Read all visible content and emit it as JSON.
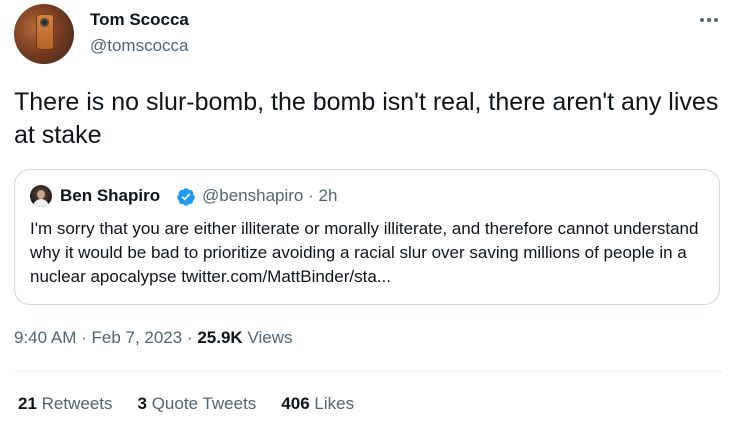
{
  "tweet": {
    "author": {
      "name": "Tom Scocca",
      "handle": "@tomscocca"
    },
    "text": "There is no slur-bomb, the bomb isn't real, there aren't any lives at stake",
    "quote": {
      "author": {
        "name": "Ben Shapiro",
        "handle": "@benshapiro",
        "verified": true
      },
      "time_sep": " · ",
      "time": "2h",
      "text": "I'm sorry that you are either illiterate or morally illiterate, and therefore cannot understand why it would be bad to prioritize avoiding a racial slur over saving millions of people in a nuclear apocalypse twitter.com/MattBinder/sta..."
    },
    "meta": {
      "time": "9:40 AM",
      "sep1": " · ",
      "date": "Feb 7, 2023",
      "sep2": " · ",
      "views_count": "25.9K",
      "views_label": " Views"
    },
    "stats": {
      "retweets_count": "21",
      "retweets_label": " Retweets",
      "quotes_count": "3",
      "quotes_label": " Quote Tweets",
      "likes_count": "406",
      "likes_label": " Likes"
    }
  },
  "icons": {
    "more": "more-horizontal-icon",
    "verified": "verified-badge-icon"
  },
  "colors": {
    "primary_text": "#0f1419",
    "secondary_text": "#536471",
    "border": "#cfd9de",
    "divider": "#eff3f4",
    "verified_blue": "#1d9bf0"
  }
}
